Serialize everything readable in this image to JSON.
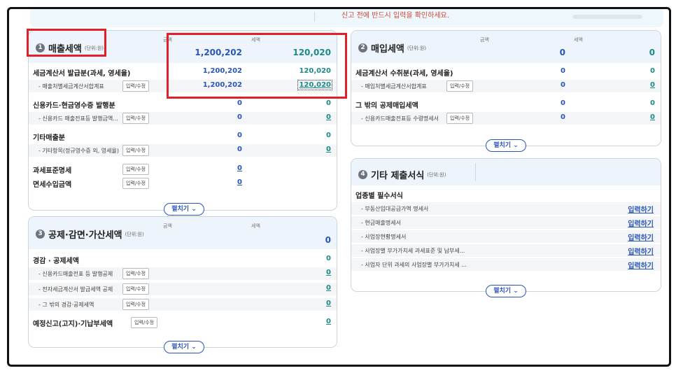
{
  "notice": "신고 전에 반드시 입력을 확인하세요.",
  "sales": {
    "title": "매출세액",
    "num": "1",
    "unit": "(단위:원)",
    "amount_header": "금액",
    "tax_header": "세액",
    "total_amount": "1,200,202",
    "total_tax": "120,020",
    "rows": [
      {
        "label": "세금계산서 발급분(과세, 영세율)",
        "amount": "1,200,202",
        "tax": "120,020"
      },
      {
        "label": "- 매출처별세금계산서합계표",
        "button": "입력/수정",
        "amount": "1,200,202",
        "tax": "120,020"
      },
      {
        "label": "신용카드·현금영수증 발행분",
        "amount": "0",
        "tax": "0"
      },
      {
        "label": "- 신용카드 매출전표등 발행금액...",
        "button": "입력/수정",
        "amount": "0",
        "tax": "0"
      },
      {
        "label": "기타매출분",
        "amount": "0",
        "tax": "0"
      },
      {
        "label": "- 기타항목(정규영수증 외, 영세율)",
        "button": "입력/수정",
        "amount": "0",
        "tax": "0"
      },
      {
        "label": "과세표준명세",
        "button": "입력/수정",
        "amount": "0"
      },
      {
        "label": "면세수입금액",
        "button": "입력/수정",
        "amount": "0"
      }
    ],
    "expand": "펼치기 ⌄"
  },
  "deduction": {
    "title": "공제·감면·가산세액",
    "num": "3",
    "unit": "(단위:원)",
    "amount_header": "금액",
    "tax_header": "세액",
    "total_tax": "0",
    "rows": [
      {
        "label": "경감 · 공제세액",
        "tax": "0"
      },
      {
        "label": "- 신용카드매출전표 등 발행공제",
        "button": "입력/수정",
        "tax": "0"
      },
      {
        "label": "- 전자세금계산서 발급세액 공제",
        "button": "입력/수정",
        "tax": "0"
      },
      {
        "label": "- 그 밖의 경감·공제세액",
        "button": "입력/수정",
        "tax": "0"
      },
      {
        "label": "예정신고(고지)·기납부세액",
        "button": "입력/수정",
        "tax": "0"
      }
    ],
    "expand": "펼치기 ⌄"
  },
  "purchase": {
    "title": "매입세액",
    "num": "2",
    "unit": "(단위:원)",
    "amount_header": "금액",
    "tax_header": "세액",
    "total_amount": "0",
    "total_tax": "0",
    "rows": [
      {
        "label": "세금계산서 수취분(과세, 영세율)",
        "amount": "0",
        "tax": "0"
      },
      {
        "label": "- 매입처별세금계산서합계표",
        "button": "입력/수정",
        "amount": "0",
        "tax": "0"
      },
      {
        "label": "그 밖의 공제매입세액",
        "amount": "0",
        "tax": "0"
      },
      {
        "label": "- 신용카드매출전표등 수령명세서",
        "button": "입력/수정",
        "amount": "0",
        "tax": "0"
      }
    ],
    "expand": "펼치기 ⌄"
  },
  "other": {
    "title": "기타 제출서식",
    "num": "4",
    "unit": "(단위:원)",
    "section": "업종별 필수서식",
    "rows": [
      {
        "label": "- 부동산임대공급가액 명세서",
        "link": "입력하기"
      },
      {
        "label": "- 현금매출명세서",
        "link": "입력하기"
      },
      {
        "label": "- 사업장현황명세서",
        "link": "입력하기"
      },
      {
        "label": "- 사업장별 부가가치세 과세표준 및 납부세...",
        "link": "입력하기"
      },
      {
        "label": "- 사업자 단위 과세의 사업장별 부가가치세 ...",
        "link": "입력하기"
      }
    ],
    "expand": "펼치기 ⌄"
  }
}
